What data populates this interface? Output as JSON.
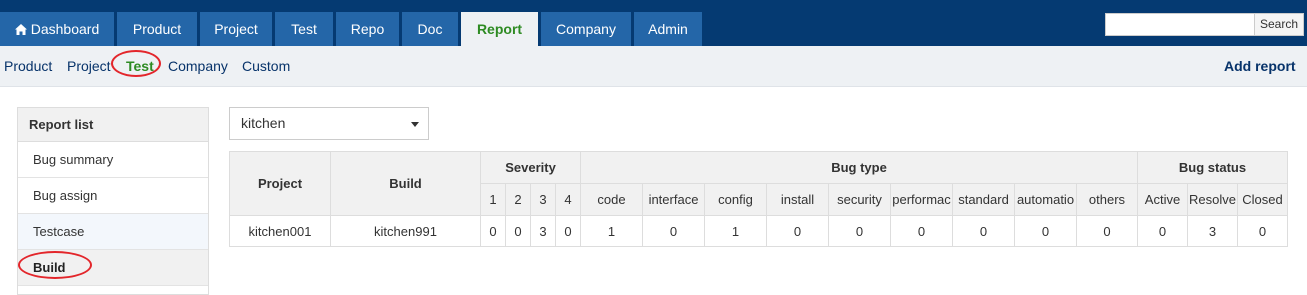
{
  "colors": {
    "nav_bg": "#053a72",
    "tab_bg": "#2466a8",
    "active_text": "#2e8b23",
    "link": "#07336a",
    "highlight_circle": "#e3262b"
  },
  "topnav": {
    "tabs": [
      {
        "label": "Dashboard",
        "icon": "home-icon"
      },
      {
        "label": "Product"
      },
      {
        "label": "Project"
      },
      {
        "label": "Test"
      },
      {
        "label": "Repo"
      },
      {
        "label": "Doc"
      },
      {
        "label": "Report",
        "active": true
      },
      {
        "label": "Company"
      },
      {
        "label": "Admin"
      }
    ],
    "search": {
      "value": "",
      "placeholder": "",
      "button_label": "Search"
    }
  },
  "subnav": {
    "items": [
      "Product",
      "Project",
      "Test",
      "Company",
      "Custom"
    ],
    "active": "Test",
    "add_report_label": "Add report"
  },
  "sidebar": {
    "title": "Report list",
    "items": [
      {
        "label": "Bug summary"
      },
      {
        "label": "Bug assign"
      },
      {
        "label": "Testcase"
      },
      {
        "label": "Build",
        "active": true
      }
    ]
  },
  "project_select": {
    "value": "kitchen"
  },
  "report_table": {
    "headers": {
      "project": "Project",
      "build": "Build",
      "severity": "Severity",
      "bug_type": "Bug type",
      "bug_status": "Bug status"
    },
    "severity_cols": [
      "1",
      "2",
      "3",
      "4"
    ],
    "bug_type_cols": [
      "code",
      "interface",
      "config",
      "install",
      "security",
      "performac",
      "standard",
      "automatio",
      "others"
    ],
    "bug_status_cols": [
      "Active",
      "Resolve",
      "Closed"
    ],
    "rows": [
      {
        "project": "kitchen001",
        "build": "kitchen991",
        "severity": [
          "0",
          "0",
          "3",
          "0"
        ],
        "bug_type": [
          "1",
          "0",
          "1",
          "0",
          "0",
          "0",
          "0",
          "0",
          "0"
        ],
        "bug_status": [
          "0",
          "3",
          "0"
        ]
      }
    ]
  }
}
